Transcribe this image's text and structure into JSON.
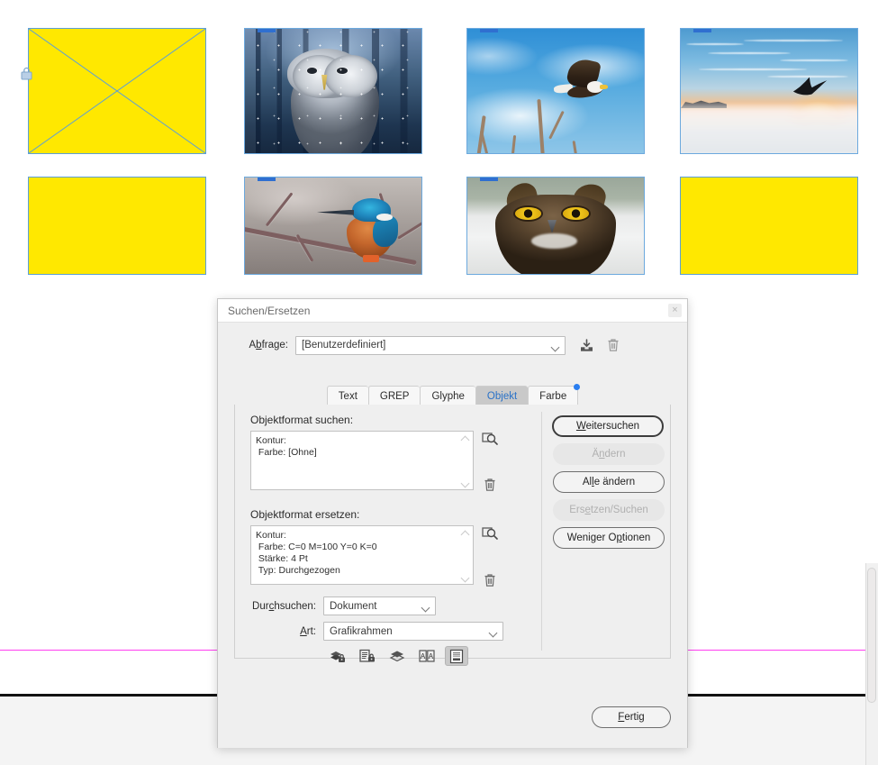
{
  "document": {
    "frames_row1": [
      {
        "name": "empty-graphic-frame",
        "type": "empty",
        "fill_color": "#ffe800",
        "locked": true,
        "linked": false,
        "alt": "Leerer Grafikrahmen"
      },
      {
        "name": "owl-forest-image",
        "type": "image",
        "art": "owl-forest",
        "linked": true,
        "alt": "Bartkauz im verschneiten Wald"
      },
      {
        "name": "eagle-sky-image",
        "type": "image",
        "art": "eagle-sky",
        "linked": true,
        "alt": "Weisskopfseeadler am blauen Himmel"
      },
      {
        "name": "sunset-bird-image",
        "type": "image",
        "art": "sunset",
        "linked": true,
        "alt": "Vogel ueber Wolkenmeer bei Sonnenuntergang"
      }
    ],
    "frames_row2": [
      {
        "name": "kingfisher-image",
        "type": "image",
        "art": "kingfisher",
        "linked": true,
        "alt": "Eisvogel auf Zweig"
      },
      {
        "name": "horned-owl-image",
        "type": "image",
        "art": "great-horned-owl",
        "linked": true,
        "alt": "Virginia-Uhu im Schnee"
      },
      {
        "name": "empty-graphic-frame-2",
        "type": "empty",
        "fill_color": "#ffe800",
        "locked": false,
        "linked": false,
        "alt": "Leerer Grafikrahmen"
      }
    ],
    "guides": {
      "margin_color": "#ff3df0",
      "page_edge_color": "#121212"
    }
  },
  "dialog": {
    "title": "Suchen/Ersetzen",
    "close_label": "×",
    "query": {
      "label": "Abfrage:",
      "label_prefix": "A",
      "label_underlined": "b",
      "label_suffix": "frage:",
      "value": "[Benutzerdefiniert]",
      "save_icon": "save-query-icon",
      "delete_icon": "delete-query-icon"
    },
    "tabs": [
      {
        "id": "text",
        "label": "Text",
        "active": false,
        "badge": false
      },
      {
        "id": "grep",
        "label": "GREP",
        "active": false,
        "badge": false
      },
      {
        "id": "glyphe",
        "label": "Glyphe",
        "active": false,
        "badge": false
      },
      {
        "id": "objekt",
        "label": "Objekt",
        "active": true,
        "badge": false
      },
      {
        "id": "farbe",
        "label": "Farbe",
        "active": false,
        "badge": true
      }
    ],
    "find_format": {
      "label": "Objektformat suchen:",
      "lines": [
        "Kontur:",
        " Farbe: [Ohne]"
      ],
      "specify_icon": "specify-attributes-icon",
      "clear_icon": "clear-attributes-icon"
    },
    "change_format": {
      "label": "Objektformat ersetzen:",
      "lines": [
        "Kontur:",
        " Farbe: C=0 M=100 Y=0 K=0",
        " Stärke: 4 Pt",
        " Typ: Durchgezogen"
      ],
      "specify_icon": "specify-attributes-icon",
      "clear_icon": "clear-attributes-icon"
    },
    "buttons": [
      {
        "id": "find-next",
        "prefix": "",
        "accel": "W",
        "suffix": "eitersuchen",
        "state": "default"
      },
      {
        "id": "change",
        "prefix": "Ä",
        "accel": "n",
        "suffix": "dern",
        "state": "disabled"
      },
      {
        "id": "change-all",
        "prefix": "Al",
        "accel": "l",
        "suffix": "e ändern",
        "state": "normal"
      },
      {
        "id": "change-find",
        "prefix": "Ers",
        "accel": "e",
        "suffix": "tzen/Suchen",
        "state": "disabled"
      },
      {
        "id": "fewer-options",
        "prefix": "Weniger O",
        "accel": "p",
        "suffix": "tionen",
        "state": "normal"
      }
    ],
    "scope": {
      "search": {
        "label_prefix": "Dur",
        "label_accel": "c",
        "label_suffix": "hsuchen:",
        "value": "Dokument"
      },
      "type": {
        "label_prefix": "",
        "label_accel": "A",
        "label_suffix": "rt:",
        "value": "Grafikrahmen"
      }
    },
    "scope_toggles": [
      {
        "id": "include-locked-layers",
        "icon": "locked-layers-icon",
        "active": false
      },
      {
        "id": "include-locked-objects",
        "icon": "locked-objects-icon",
        "active": false
      },
      {
        "id": "include-hidden-layers",
        "icon": "hidden-layers-icon",
        "active": false
      },
      {
        "id": "include-master-pages",
        "icon": "master-pages-icon",
        "active": false
      },
      {
        "id": "include-footnotes",
        "icon": "footnotes-icon",
        "active": true
      }
    ],
    "footer": {
      "done_prefix": "",
      "done_accel": "F",
      "done_suffix": "ertig"
    }
  },
  "colors": {
    "accent_blue": "#2a72c8",
    "badge_blue": "#2a7ef0",
    "frame_yellow": "#ffe800",
    "frame_border": "#5d9fd6",
    "magenta_guide": "#ff3df0",
    "dialog_bg": "#efefef"
  }
}
